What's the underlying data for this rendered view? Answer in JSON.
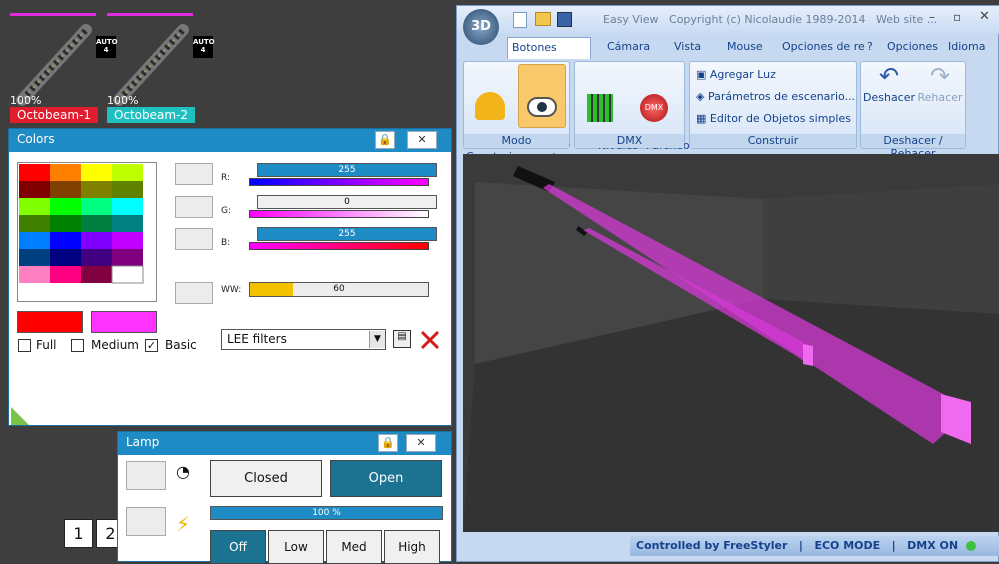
{
  "fixtures": [
    {
      "name": "Octobeam-1",
      "percent": "100%",
      "auto_badge": "AUTO\n4",
      "color": "#e01c2e"
    },
    {
      "name": "Octobeam-2",
      "percent": "100%",
      "auto_badge": "AUTO\n4",
      "color": "#20c0c0"
    }
  ],
  "colors_window": {
    "title": "Colors",
    "labels": {
      "r": "R:",
      "g": "G:",
      "b": "B:",
      "ww": "WW:"
    },
    "values": {
      "r": "255",
      "g": "0",
      "b": "255",
      "ww": "60"
    },
    "checkboxes": [
      {
        "label": "Full",
        "checked": false
      },
      {
        "label": "Medium",
        "checked": false
      },
      {
        "label": "Basic",
        "checked": true
      }
    ],
    "basic_check": "✓",
    "filter_select": "LEE filters",
    "page_buttons": [
      "1",
      "2"
    ],
    "palette_colors": [
      "#e00000",
      "#18d818",
      "#0000ff",
      "#f6e82a",
      "#00ffff",
      "#ff00ff",
      "#000000"
    ],
    "current_color": "#ff0000",
    "target_color": "#ff33ff"
  },
  "lamp_window": {
    "title": "Lamp",
    "closed": "Closed",
    "open": "Open",
    "intensity": "100 %",
    "power": [
      "Off",
      "Low",
      "Med",
      "High"
    ]
  },
  "app": {
    "title": "Easy View   Copyright (c) Nicolaudie 1989-2014   Web site ...",
    "logo": "3D",
    "tabs": [
      "Botones estándar",
      "Cámara",
      "Vista",
      "Mouse",
      "Opciones de re"
    ],
    "help": "?",
    "options": "Opciones",
    "language": "Idioma",
    "groups": {
      "modo": {
        "label": "Modo",
        "construir": "Modo\nConstruir",
        "usuario": "Modo\nusuario"
      },
      "dmx": {
        "label": "DMX",
        "niveles": "Niveles\nDMX",
        "parcheo": "Parcheo de\nUniversos"
      },
      "construir": {
        "label": "Construir",
        "items": [
          "Agregar Luz",
          "Parámetros de escenario...",
          "Editor de Objetos simples"
        ]
      },
      "deshacer": {
        "label": "Deshacer / Rehacer",
        "undo": "Deshacer",
        "redo": "Rehacer"
      }
    },
    "status": "Controlled by FreeStyler   |   ECO MODE   |   DMX ON"
  }
}
